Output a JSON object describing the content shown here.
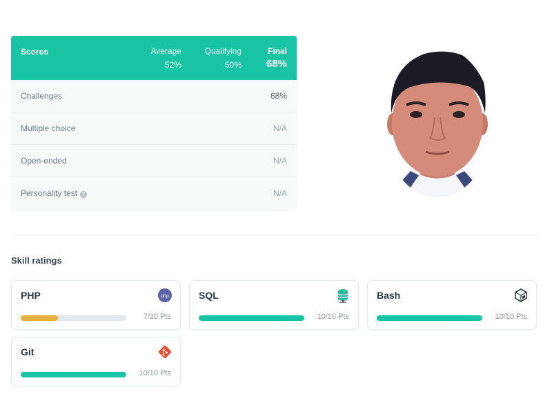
{
  "scores": {
    "title": "Scores",
    "average": {
      "label": "Average",
      "value": "52%"
    },
    "qualifying": {
      "label": "Qualifying",
      "value": "50%"
    },
    "final": {
      "label": "Final",
      "value": "68%"
    },
    "rows": [
      {
        "label": "Challenges",
        "value": "68%"
      },
      {
        "label": "Multiple choice",
        "value": "N/A"
      },
      {
        "label": "Open-ended",
        "value": "N/A"
      },
      {
        "label": "Personality test",
        "value": "N/A"
      }
    ]
  },
  "profile": {
    "avatar_icon": "person-photo"
  },
  "skills": {
    "title": "Skill ratings",
    "items": [
      {
        "name": "PHP",
        "points": "7/20 Pts",
        "fraction": 0.35,
        "color": "#e5b040",
        "icon": "php-icon"
      },
      {
        "name": "SQL",
        "points": "10/10 Pts",
        "fraction": 1.0,
        "color": "#18c4a3",
        "icon": "database-icon"
      },
      {
        "name": "Bash",
        "points": "10/10 Pts",
        "fraction": 1.0,
        "color": "#18c4a3",
        "icon": "terminal-cube-icon"
      },
      {
        "name": "Git",
        "points": "10/10 Pts",
        "fraction": 1.0,
        "color": "#18c4a3",
        "icon": "git-icon"
      }
    ]
  },
  "colors": {
    "accent": "#18c4a3",
    "warning": "#e5b040",
    "track": "#e2e8ef"
  }
}
